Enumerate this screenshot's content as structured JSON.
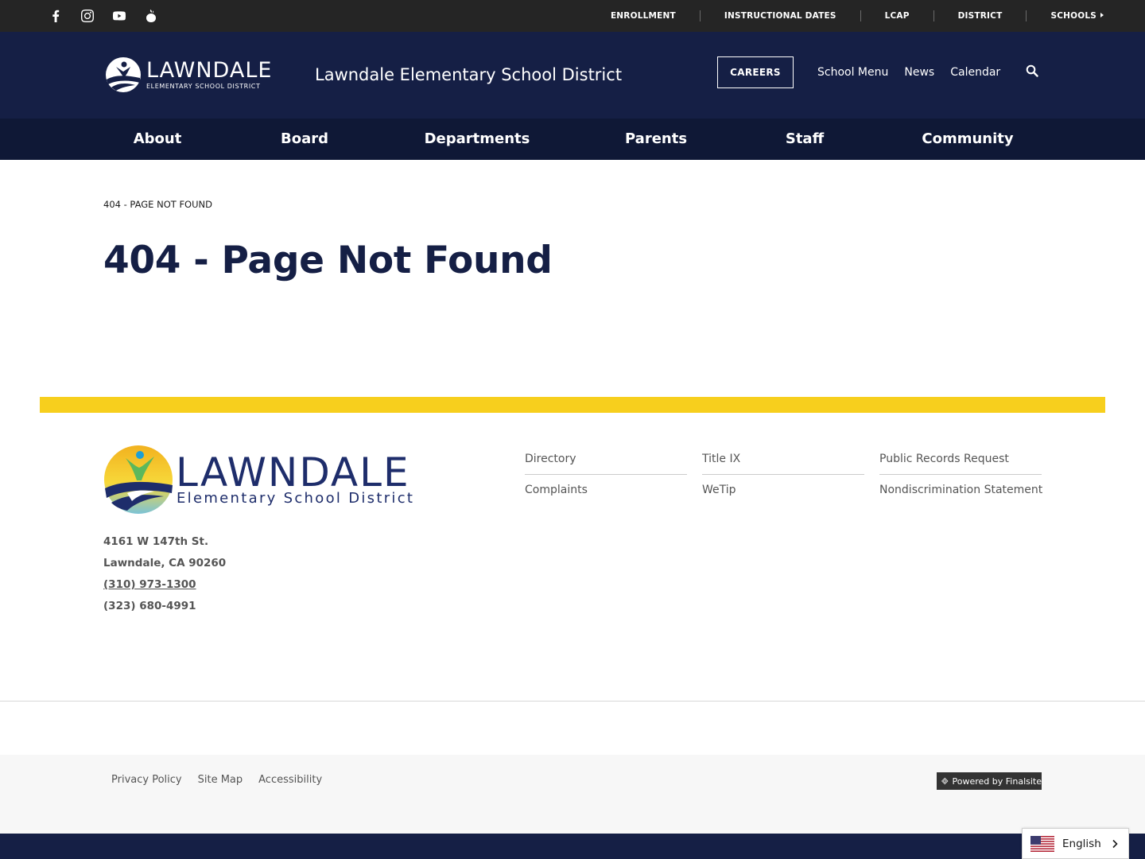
{
  "social": [
    {
      "name": "facebook-icon",
      "label": "Facebook"
    },
    {
      "name": "instagram-icon",
      "label": "Instagram"
    },
    {
      "name": "youtube-icon",
      "label": "YouTube"
    },
    {
      "name": "peachjar-icon",
      "label": "Peachjar"
    }
  ],
  "utility": {
    "enrollment": "ENROLLMENT",
    "instructional_dates": "INSTRUCTIONAL DATES",
    "lcap": "LCAP",
    "district": "DISTRICT",
    "schools": "SCHOOLS"
  },
  "header": {
    "logo_big": "LAWNDALE",
    "logo_small": "ELEMENTARY SCHOOL DISTRICT",
    "site_name": "Lawndale Elementary School District",
    "careers": "CAREERS",
    "links": {
      "school_menu": "School Menu",
      "news": "News",
      "calendar": "Calendar"
    }
  },
  "nav": {
    "about": "About",
    "board": "Board",
    "departments": "Departments",
    "parents": "Parents",
    "staff": "Staff",
    "community": "Community"
  },
  "content": {
    "breadcrumb": "404 - PAGE NOT FOUND",
    "title": "404 - Page Not Found"
  },
  "footer": {
    "logo_big": "LAWNDALE",
    "logo_small": "Elementary School District",
    "address_line1": "4161 W 147th St.",
    "address_line2": "Lawndale, CA  90260",
    "phone1": "(310) 973-1300",
    "phone2": "(323) 680-4991",
    "links": {
      "directory": "Directory",
      "complaints": "Complaints",
      "title_ix": "Title IX",
      "wetip": "WeTip",
      "public_records": "Public Records Request",
      "nondiscrimination": "Nondiscrimination Statement"
    },
    "legal": {
      "privacy": "Privacy Policy",
      "sitemap": "Site Map",
      "accessibility": "Accessibility"
    },
    "powered": "Powered by Finalsite"
  },
  "language": {
    "selected": "English"
  },
  "colors": {
    "navy": "#151f45",
    "navy_dark": "#0f1836",
    "utility_bg": "#252525",
    "accent_yellow": "#f7cf1d"
  }
}
